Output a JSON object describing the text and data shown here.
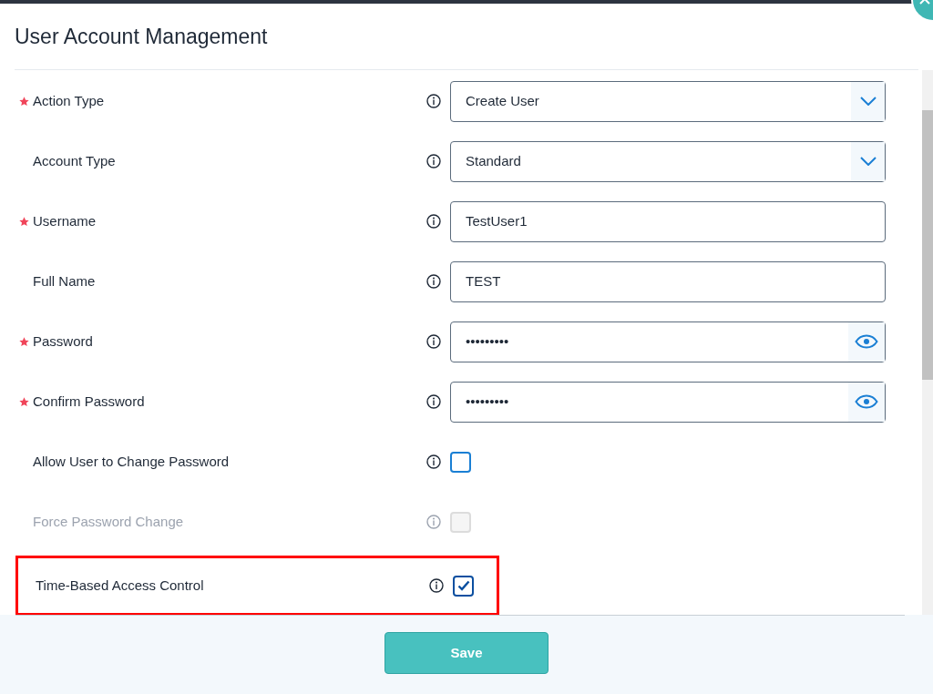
{
  "dialog": {
    "title": "User Account Management"
  },
  "fields": [
    {
      "kind": "select",
      "label": "Action Type",
      "required": true,
      "value": "Create User",
      "highlighted": false
    },
    {
      "kind": "select",
      "label": "Account Type",
      "required": false,
      "value": "Standard",
      "highlighted": false
    },
    {
      "kind": "text",
      "label": "Username",
      "required": true,
      "value": "TestUser1",
      "highlighted": false
    },
    {
      "kind": "text",
      "label": "Full Name",
      "required": false,
      "value": "TEST",
      "highlighted": false
    },
    {
      "kind": "password",
      "label": "Password",
      "required": true,
      "value": "•••••••••",
      "highlighted": false
    },
    {
      "kind": "password",
      "label": "Confirm Password",
      "required": true,
      "value": "•••••••••",
      "highlighted": false
    },
    {
      "kind": "checkbox",
      "label": "Allow User to Change Password",
      "required": false,
      "checked": false,
      "disabled": false,
      "highlighted": false
    },
    {
      "kind": "checkbox",
      "label": "Force Password Change",
      "required": false,
      "checked": false,
      "disabled": true,
      "highlighted": false
    },
    {
      "kind": "checkbox",
      "label": "Time-Based Access Control",
      "required": false,
      "checked": true,
      "disabled": false,
      "highlighted": true
    }
  ],
  "footer": {
    "button": "Save"
  }
}
